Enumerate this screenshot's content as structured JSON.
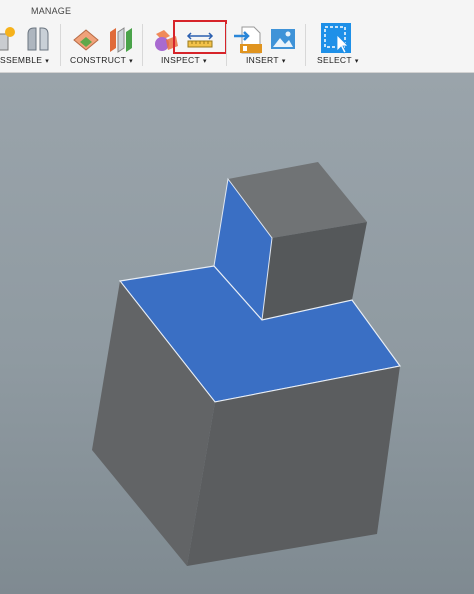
{
  "toolbar": {
    "tab_label": "MANAGE",
    "groups": [
      {
        "label": "SSEMBLE",
        "caret": "▾"
      },
      {
        "label": "CONSTRUCT",
        "caret": "▾"
      },
      {
        "label": "INSPECT",
        "caret": "▾"
      },
      {
        "label": "INSERT",
        "caret": "▾"
      },
      {
        "label": "SELECT",
        "caret": "▾"
      }
    ],
    "icons": [
      "new-component-icon",
      "joint-icon",
      "offset-plane-icon",
      "midplane-icon",
      "interference-icon",
      "measure-icon",
      "insert-mesh-icon",
      "insert-image-icon",
      "select-icon"
    ]
  },
  "colors": {
    "face_selected": "#3a6fc4",
    "face_dark": "#5b5d5f",
    "face_light": "#6d7072",
    "highlight": "#d7242a",
    "select_blue": "#1e90e8"
  }
}
